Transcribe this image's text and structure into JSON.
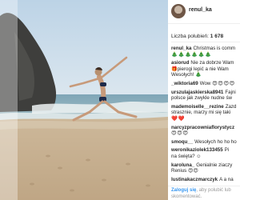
{
  "post": {
    "username": "renul_ka",
    "likes_label": "Liczba polubień:",
    "likes_count": "1 678"
  },
  "comments": [
    {
      "user": "renul_ka",
      "text": "Christmas is comm",
      "emojis": [
        "🎄",
        "🎄",
        "🎄",
        "🎄",
        "🎄",
        "🎄"
      ]
    },
    {
      "user": "asiorud",
      "text": "Nie za dobrze Wam",
      "line2": "pierogi lepić a nie Wam",
      "line3": "Wesołych! 🎄",
      "prefix_emoji": "🎁"
    },
    {
      "user": "_wiktoria69",
      "text": "Wow",
      "emojis": [
        "😍",
        "😍",
        "😍",
        "😍"
      ]
    },
    {
      "user": "urszulajaskierska8941",
      "text": "Fajni",
      "line2": "polsce jak zwykle nudne św"
    },
    {
      "user": "mademoiselle__rezine",
      "text": "Zazd",
      "line2": "strasznie, marzy mi się taki",
      "emojis": [
        "❤️",
        "❤️"
      ]
    },
    {
      "user": "narcyzpracowniaflorystycz",
      "emojis": [
        "😍",
        "😍",
        "😍"
      ]
    },
    {
      "user": "smoqu__",
      "text": "Wesołych ho ho ho"
    },
    {
      "user": "weronikaziolek133455",
      "text": "Pi",
      "line2": "na święta? ☺"
    },
    {
      "user": "karoluna_",
      "text": "Genialnie ziaczy",
      "line2": "Renius 😍😍"
    },
    {
      "user": "lustinakaczmarczyk",
      "text": "A a na"
    }
  ],
  "footer": {
    "login_link": "Zaloguj się",
    "login_rest": ", aby polubić lub",
    "line2": "skomentować."
  }
}
